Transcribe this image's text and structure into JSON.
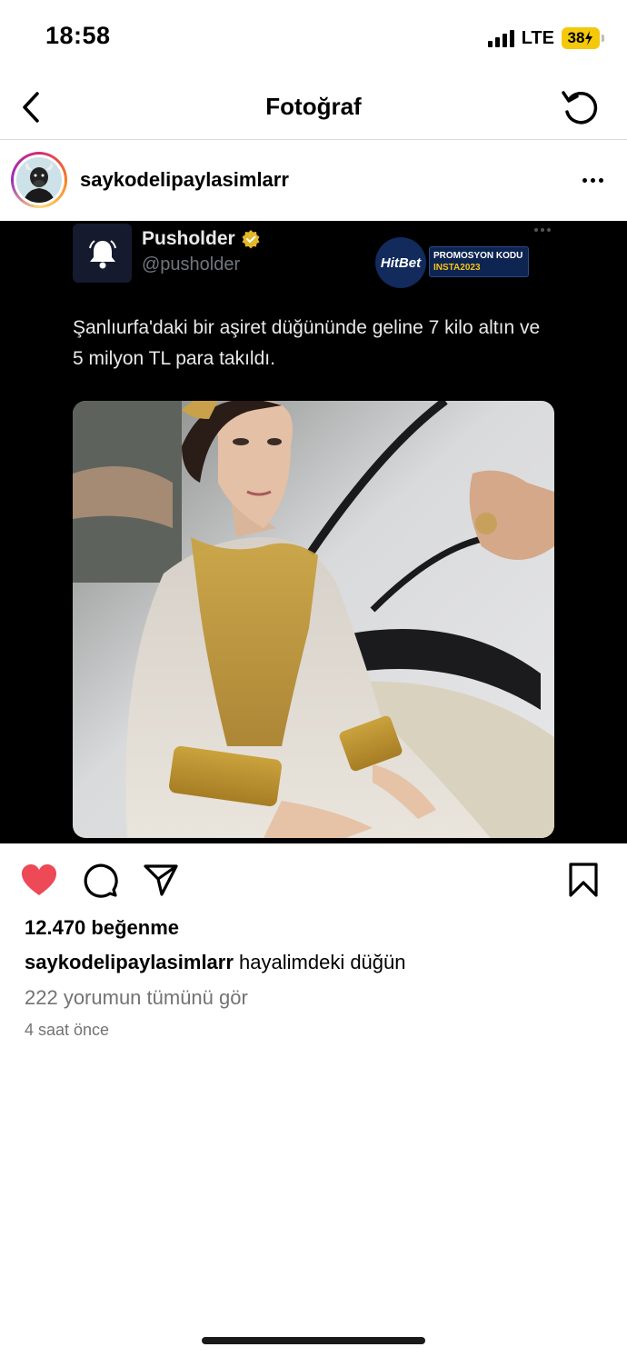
{
  "status_bar": {
    "time": "18:58",
    "network": "LTE",
    "battery": "38"
  },
  "nav": {
    "title": "Fotoğraf",
    "icons": [
      "chevron-left-icon",
      "refresh-icon"
    ]
  },
  "post": {
    "username": "saykodelipaylasimlarr",
    "image": {
      "tweet_name": "Pusholder",
      "tweet_handle": "@pusholder",
      "tweet_text": "Şanlıurfa'daki bir aşiret düğününde geline 7 kilo altın ve 5 milyon TL para takıldı.",
      "ad_brand": "HitBet",
      "promo_line1": "PROMOSYON KODU",
      "promo_line2": "INSTA2023"
    },
    "likes": "12.470 beğenme",
    "caption_text": " hayalimdeki düğün",
    "view_comments": "222 yorumun tümünü gör",
    "timestamp": "4 saat önce",
    "liked": true,
    "colors": {
      "like": "#ed4956",
      "muted_text": "#737373",
      "battery": "#f4c90b"
    }
  }
}
